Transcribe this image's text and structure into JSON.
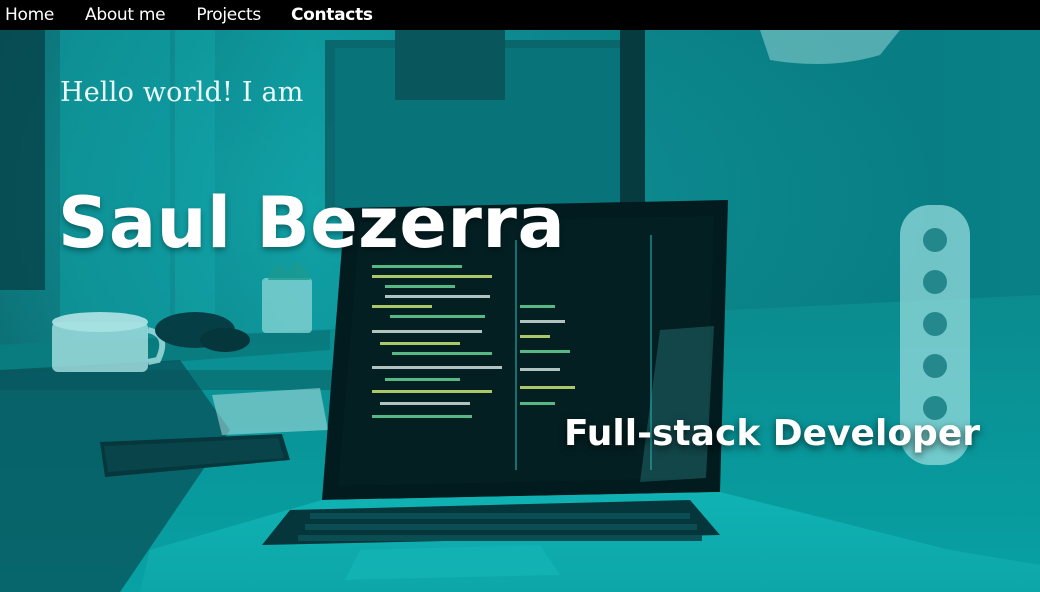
{
  "nav": {
    "items": [
      {
        "label": "Home"
      },
      {
        "label": "About me"
      },
      {
        "label": "Projects"
      },
      {
        "label": "Contacts",
        "active": true
      }
    ]
  },
  "hero": {
    "greeting": "Hello world! I am",
    "name": "Saul Bezerra",
    "role": "Full-stack Developer",
    "background_image": "desk-laptop-photo",
    "tint_color": "#0a9a9e"
  },
  "colors": {
    "nav_bg": "#000000",
    "text": "#ffffff",
    "accent_tint": "#0a9a9e"
  }
}
